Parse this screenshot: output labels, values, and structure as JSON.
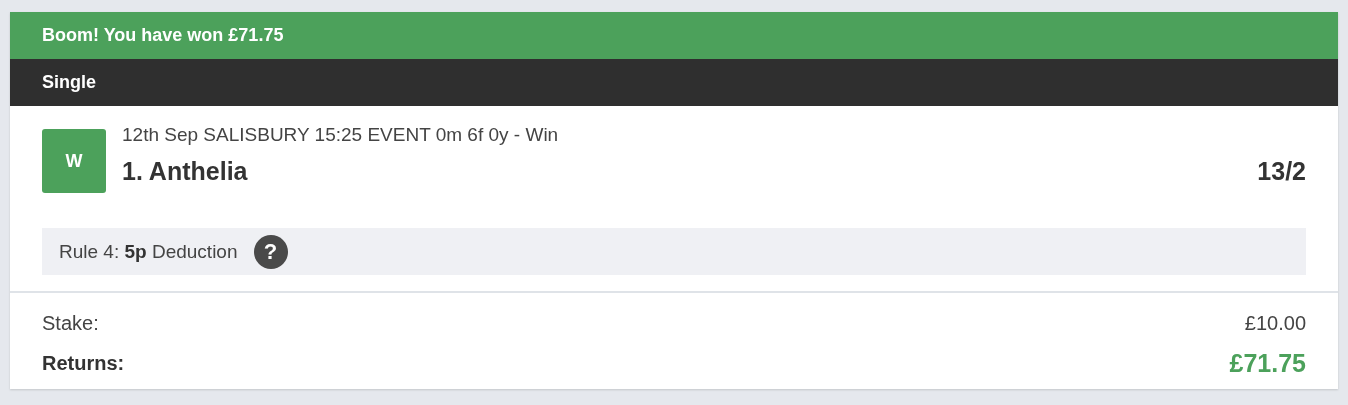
{
  "banner": {
    "text": "Boom! You have won £71.75"
  },
  "bet_type": "Single",
  "selection": {
    "result_badge": "W",
    "won": true,
    "event": "12th Sep SALISBURY 15:25 EVENT 0m 6f 0y - Win",
    "name": "1. Anthelia",
    "odds": "13/2"
  },
  "rule_note": {
    "text": "Rule 4: **5p** Deduction",
    "help_icon": "?"
  },
  "summary": [
    {
      "kind": "plain",
      "label": "Stake:",
      "value": "£10.00"
    },
    {
      "kind": "returns",
      "label": "Returns:",
      "value": "£71.75"
    }
  ]
}
